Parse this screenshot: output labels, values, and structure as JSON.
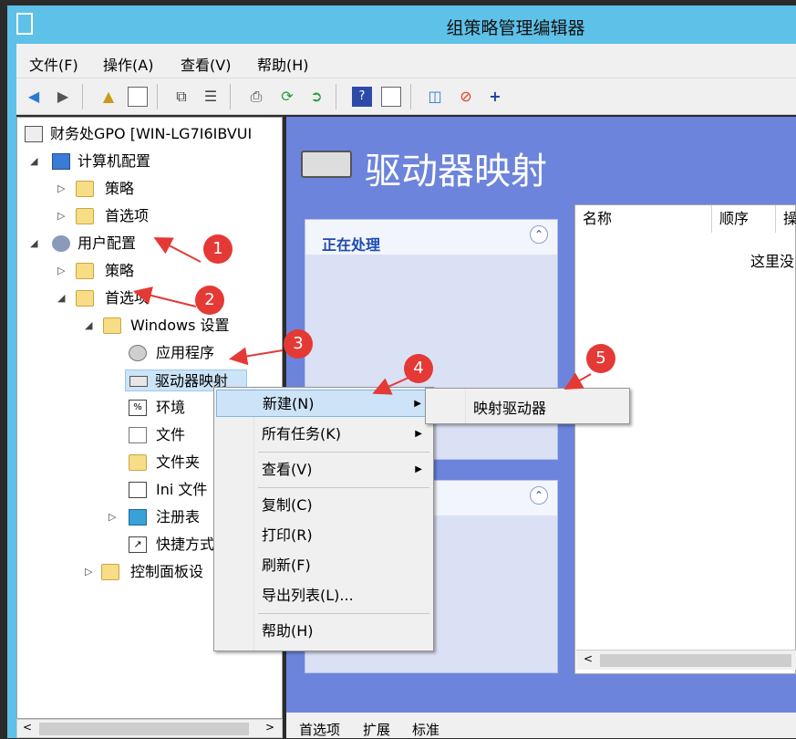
{
  "window": {
    "title": "组策略管理编辑器"
  },
  "menu": [
    "文件(F)",
    "操作(A)",
    "查看(V)",
    "帮助(H)"
  ],
  "tree": {
    "root": "财务处GPO [WIN-LG7I6IBVUI",
    "computer_config": "计算机配置",
    "cc_policy": "策略",
    "cc_prefs": "首选项",
    "user_config": "用户配置",
    "uc_policy": "策略",
    "uc_prefs": "首选项",
    "windows_settings": "Windows 设置",
    "applications": "应用程序",
    "drive_maps": "驱动器映射",
    "environment": "环境",
    "files": "文件",
    "folders": "文件夹",
    "ini_files": "Ini 文件",
    "registry": "注册表",
    "shortcuts": "快捷方式",
    "control_panel": "控制面板设"
  },
  "right": {
    "heading": "驱动器映射",
    "processing_label": "正在处理",
    "columns": [
      "名称",
      "顺序",
      "操"
    ],
    "empty_text": "这里没"
  },
  "tabs": [
    "首选项",
    "扩展",
    "标准"
  ],
  "context_menu": {
    "items": [
      "新建(N)",
      "所有任务(K)",
      "查看(V)",
      "复制(C)",
      "打印(R)",
      "刷新(F)",
      "导出列表(L)...",
      "帮助(H)"
    ]
  },
  "submenu": {
    "item": "映射驱动器"
  },
  "badges": [
    "1",
    "2",
    "3",
    "4",
    "5"
  ],
  "colors": {
    "titlebar": "#5ec1e8",
    "content_bg": "#6d84dc",
    "badge": "#e53935",
    "arrow": "#e53935"
  }
}
